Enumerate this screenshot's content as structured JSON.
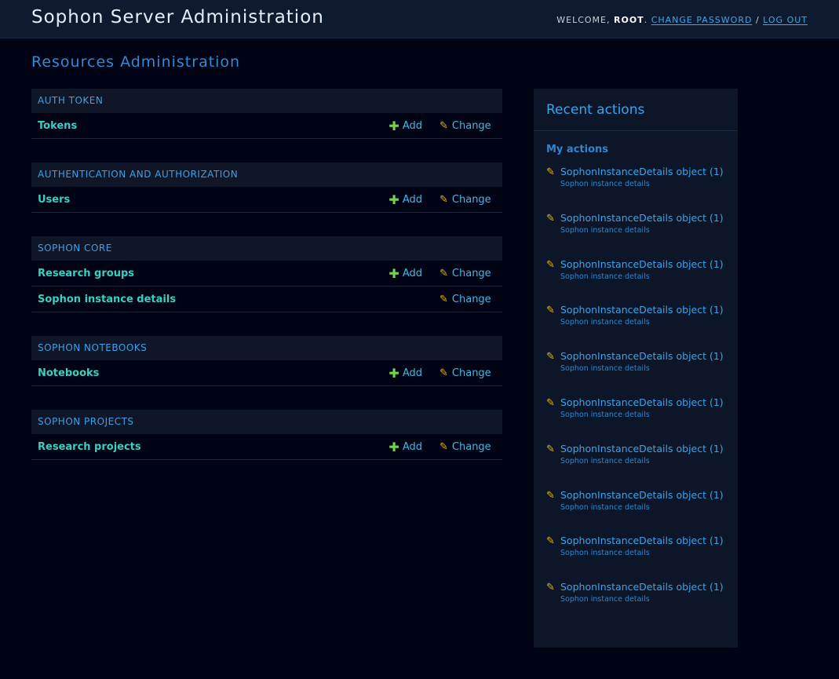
{
  "header": {
    "site_title": "Sophon Server Administration",
    "welcome_text": "WELCOME,",
    "username": "ROOT",
    "period": ".",
    "change_password": "CHANGE PASSWORD",
    "separator": "/",
    "log_out": "LOG OUT"
  },
  "page_title": "Resources Administration",
  "apps": [
    {
      "caption": "AUTH TOKEN",
      "models": [
        {
          "name": "Tokens",
          "add_label": "Add",
          "change_label": "Change"
        }
      ]
    },
    {
      "caption": "AUTHENTICATION AND AUTHORIZATION",
      "models": [
        {
          "name": "Users",
          "add_label": "Add",
          "change_label": "Change"
        }
      ]
    },
    {
      "caption": "SOPHON CORE",
      "models": [
        {
          "name": "Research groups",
          "add_label": "Add",
          "change_label": "Change"
        },
        {
          "name": "Sophon instance details",
          "add_label": "",
          "change_label": "Change"
        }
      ]
    },
    {
      "caption": "SOPHON NOTEBOOKS",
      "models": [
        {
          "name": "Notebooks",
          "add_label": "Add",
          "change_label": "Change"
        }
      ]
    },
    {
      "caption": "SOPHON PROJECTS",
      "models": [
        {
          "name": "Research projects",
          "add_label": "Add",
          "change_label": "Change"
        }
      ]
    }
  ],
  "recent_actions": {
    "title": "Recent actions",
    "subtitle": "My actions",
    "items": [
      {
        "title": "SophonInstanceDetails object (1)",
        "type": "Sophon instance details"
      },
      {
        "title": "SophonInstanceDetails object (1)",
        "type": "Sophon instance details"
      },
      {
        "title": "SophonInstanceDetails object (1)",
        "type": "Sophon instance details"
      },
      {
        "title": "SophonInstanceDetails object (1)",
        "type": "Sophon instance details"
      },
      {
        "title": "SophonInstanceDetails object (1)",
        "type": "Sophon instance details"
      },
      {
        "title": "SophonInstanceDetails object (1)",
        "type": "Sophon instance details"
      },
      {
        "title": "SophonInstanceDetails object (1)",
        "type": "Sophon instance details"
      },
      {
        "title": "SophonInstanceDetails object (1)",
        "type": "Sophon instance details"
      },
      {
        "title": "SophonInstanceDetails object (1)",
        "type": "Sophon instance details"
      },
      {
        "title": "SophonInstanceDetails object (1)",
        "type": "Sophon instance details"
      }
    ]
  },
  "icons": {
    "add": "plus-icon",
    "change": "pencil-icon"
  },
  "colors": {
    "background": "#000314",
    "header": "#0e1a30",
    "model_link": "#38d0c2",
    "accent_blue": "#3aa4ea",
    "add_icon": "#6ed84a",
    "change_icon": "#e8b31a"
  }
}
